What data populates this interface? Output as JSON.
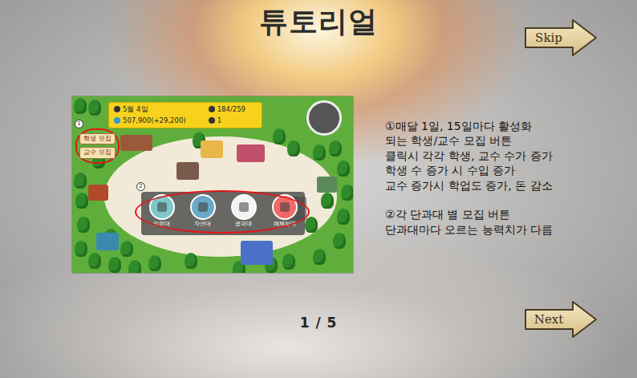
{
  "title": "튜토리얼",
  "skip_button": "Skip",
  "next_button": "Next",
  "page": "1 / 5",
  "game_screenshot": {
    "date": "5월 4일",
    "students": "184/259",
    "money": "507,900(+29,200)",
    "professors": "1",
    "markers": [
      "1",
      "2"
    ],
    "recruit_buttons": [
      "학생 모집",
      "교수 모집"
    ],
    "colleges": [
      {
        "label": "인문대",
        "color": "#7ec8c8"
      },
      {
        "label": "자연대",
        "color": "#6aa8c8"
      },
      {
        "label": "공과대",
        "color": "#f4f4f4"
      },
      {
        "label": "예체능대",
        "color": "#f06a6a"
      }
    ]
  },
  "description": {
    "sections": [
      [
        "①매달 1일, 15일마다 활성화",
        "되는 학생/교수 모집 버튼",
        "클릭시 각각 학생, 교수 수가 증가",
        "학생 수 증가 시 수입 증가",
        "교수 증가시 학업도 증가, 돈 감소"
      ],
      [
        "②각 단과대 별 모집 버튼",
        "단과대마다 오르는 능력치가 다름"
      ]
    ]
  }
}
